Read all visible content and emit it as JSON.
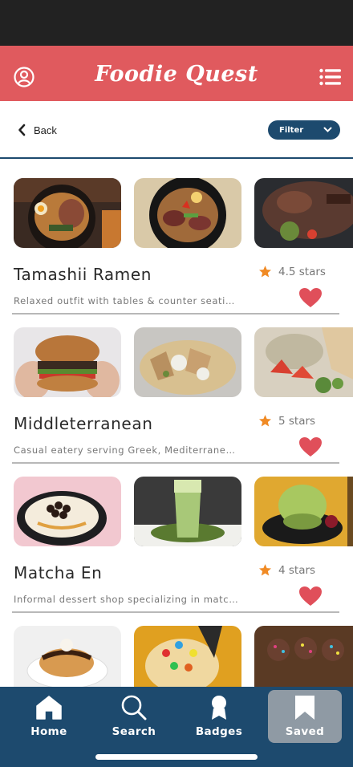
{
  "header": {
    "title": "Foodie Quest",
    "profile_icon": "user-circle-icon",
    "menu_icon": "hamburger-menu-icon"
  },
  "toolbar": {
    "back_label": "Back",
    "filter_label": "Filter"
  },
  "colors": {
    "header_bg": "#e05a5e",
    "primary": "#1d4a6e",
    "star": "#f08a24",
    "heart": "#e04f5a",
    "nav_active": "#8f9aa4"
  },
  "restaurants": [
    {
      "name": "Tamashii Ramen",
      "rating": "4.5 stars",
      "description": "Relaxed outfit with tables & counter seating serving ramen",
      "saved": true
    },
    {
      "name": "Middleterranean",
      "rating": "5 stars",
      "description": "Casual eatery serving Greek, Mediterranean dishes",
      "saved": true
    },
    {
      "name": "Matcha En",
      "rating": "4 stars",
      "description": "Informal dessert shop specializing in matcha",
      "saved": true
    },
    {
      "name": "",
      "rating": "",
      "description": "",
      "saved": true
    }
  ],
  "nav": {
    "items": [
      {
        "label": "Home",
        "icon": "home-icon"
      },
      {
        "label": "Search",
        "icon": "search-icon"
      },
      {
        "label": "Badges",
        "icon": "badge-icon"
      },
      {
        "label": "Saved",
        "icon": "bookmark-icon"
      }
    ],
    "active": "Saved"
  }
}
